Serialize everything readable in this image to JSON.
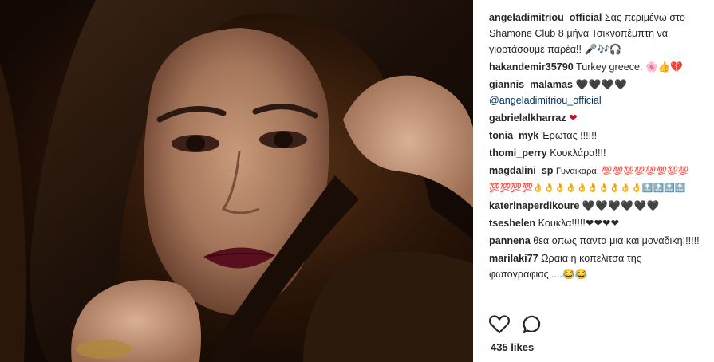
{
  "post": {
    "caption": {
      "user": "angeladimitriou_official",
      "text": "Σας περιμένω στο Shamone Club 8 μήνα Τσικνοπέμπτη να γιορτάσουμε παρέα!! 🎤🎶🎧"
    },
    "comments": [
      {
        "user": "hakandemir35790",
        "text": "Turkey greece. 🌸👍💔"
      },
      {
        "user": "giannis_malamas",
        "text": "🖤🖤🖤🖤",
        "mention": "@angeladimitriou_official"
      },
      {
        "user": "gabrielalkharraz",
        "text": "❤"
      },
      {
        "user": "tonia_myk",
        "text": "Έρωτας !!!!!!"
      },
      {
        "user": "thomi_perry",
        "text": "Κουκλάρα!!!!"
      },
      {
        "user": "magdalini_sp",
        "text": "Γυναικαρα. 💯💯💯💯💯💯💯💯💯💯💯💯👌👌👌👌👌👌👌👌👌👌🔝🔝🔝🔝"
      },
      {
        "user": "katerinaperdikoure",
        "text": "🖤🖤🖤🖤🖤🖤"
      },
      {
        "user": "tseshelen",
        "text": "Κουκλα!!!!!❤❤❤❤"
      },
      {
        "user": "pannena",
        "text": "θεα οπως παντα μια και μοναδικη!!!!!!"
      },
      {
        "user": "marilaki77",
        "text": "Ωραια η κοπελιτσα της φωτογραφιας.....😂😂"
      }
    ],
    "likes": "435 likes",
    "icons": {
      "like": "heart-outline-icon",
      "comment": "speech-bubble-icon"
    }
  }
}
